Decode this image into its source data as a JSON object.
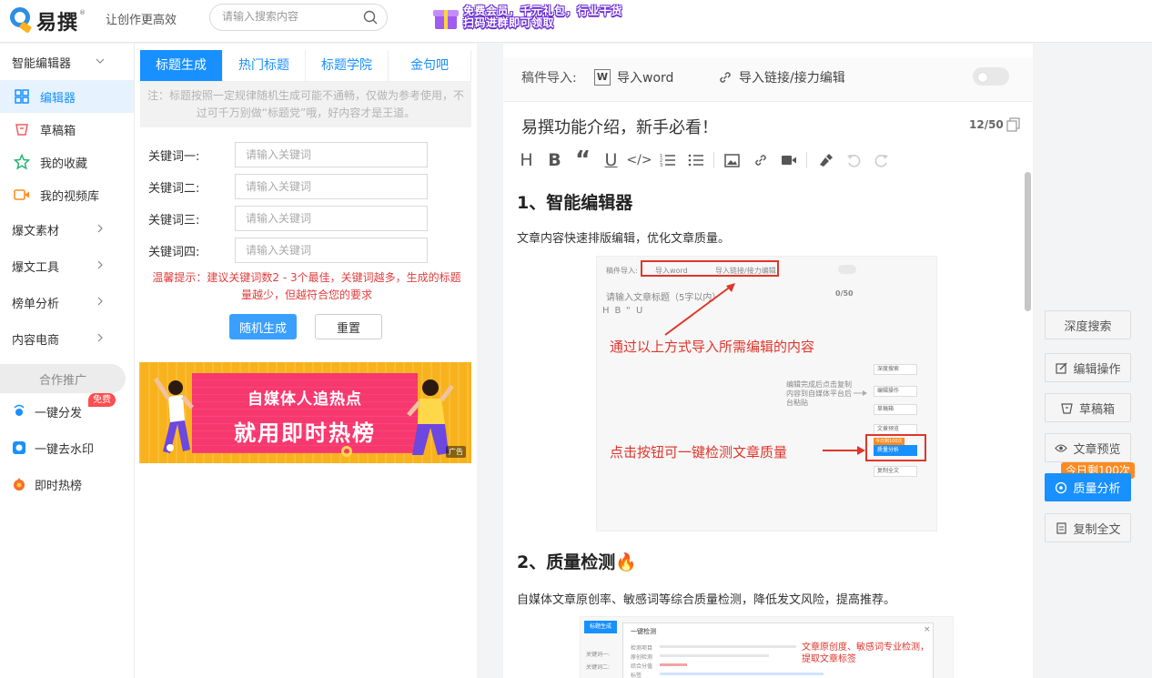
{
  "header": {
    "logo_text": "易撰",
    "logo_mark": "®",
    "slogan": "让创作更高效",
    "search_placeholder": "请输入搜索内容",
    "promo_line1": "免费会员，千元礼包，行业干货",
    "promo_line2": "扫码进群即可领取"
  },
  "sidebar": {
    "editor_group": "智能编辑器",
    "items": [
      {
        "label": "编辑器",
        "icon": "grid-icon"
      },
      {
        "label": "草稿箱",
        "icon": "draft-box-icon"
      },
      {
        "label": "我的收藏",
        "icon": "star-icon"
      },
      {
        "label": "我的视频库",
        "icon": "video-icon"
      }
    ],
    "groups": [
      "爆文素材",
      "爆文工具",
      "榜单分析",
      "内容电商"
    ],
    "coop_label": "合作推广",
    "promo_items": [
      {
        "label": "一键分发",
        "icon": "distribute-icon",
        "badge": "免费"
      },
      {
        "label": "一键去水印",
        "icon": "watermark-icon"
      },
      {
        "label": "即时热榜",
        "icon": "hot-list-icon"
      }
    ]
  },
  "title_tool": {
    "tabs": [
      "标题生成",
      "热门标题",
      "标题学院",
      "金句吧"
    ],
    "notice": "注：标题按照一定规律随机生成可能不通畅，仅做为参考使用，不过可千万别做“标题党”哦，好内容才是王道。",
    "keywords": [
      {
        "label": "关键词一:",
        "placeholder": "请输入关键词"
      },
      {
        "label": "关键词二:",
        "placeholder": "请输入关键词"
      },
      {
        "label": "关键词三:",
        "placeholder": "请输入关键词"
      },
      {
        "label": "关键词四:",
        "placeholder": "请输入关键词"
      }
    ],
    "tip": "温馨提示：建议关键词数2 - 3个最佳，关键词越多，生成的标题量越少，但越符合您的要求",
    "generate_label": "随机生成",
    "reset_label": "重置",
    "ad_line1": "自媒体人追热点",
    "ad_line2": "就用即时热榜",
    "ad_tag": "广告"
  },
  "editor": {
    "import_label": "稿件导入:",
    "import_word": "导入word",
    "import_link": "导入链接/接力编辑",
    "title": "易撰功能介绍，新手必看！",
    "title_count": "12/50",
    "toolbar": [
      "H",
      "B",
      "“",
      "U",
      "</>",
      "ordered-list",
      "bullet-list",
      "image",
      "link",
      "video",
      "clear-format",
      "undo",
      "redo"
    ],
    "section1_title": "1、智能编辑器",
    "section1_text": "文章内容快速排版编辑，优化文章质量。",
    "shot1": {
      "import_label": "稿件导入:",
      "import_word": "导入word",
      "import_link": "导入链接/接力编辑",
      "title_placeholder": "请输入文章标题（5字以内）",
      "count": "0/50",
      "caption1": "通过以上方式导入所需编辑的内容",
      "note": "编辑完成后点击复制内容到自媒体平台后台粘贴",
      "mini_tools": [
        "深度搜索",
        "编辑操作",
        "草稿箱",
        "文章预览",
        "质量分析",
        "复制全文"
      ],
      "mini_badge": "今日剩100次",
      "caption2": "点击按钮可一键检测文章质量"
    },
    "section2_title": "2、质量检测",
    "section2_emoji": "🔥",
    "section2_text": "自媒体文章原创率、敏感词等综合质量检测，降低发文风险，提高推荐。",
    "shot2": {
      "tab": "标题生成",
      "modal_title": "一键检测",
      "caption": "文章原创度、敏感词专业检测，提取文章标签",
      "labels": [
        "关键词一:",
        "关键词二:"
      ],
      "rows": [
        "检测项目",
        "原创检测",
        "综合分值",
        "标签"
      ]
    }
  },
  "right_tools": {
    "deep_search": "深度搜索",
    "edit_ops": "编辑操作",
    "drafts": "草稿箱",
    "preview": "文章预览",
    "quality": "质量分析",
    "quality_badge": "今日剩100次",
    "copy_all": "复制全文"
  },
  "colors": {
    "accent": "#1890ff",
    "warning_text": "#e03e3e",
    "badge_orange": "#ff8a1f",
    "ad_yellow": "#f8b21c",
    "ad_pink": "#f7386f"
  }
}
